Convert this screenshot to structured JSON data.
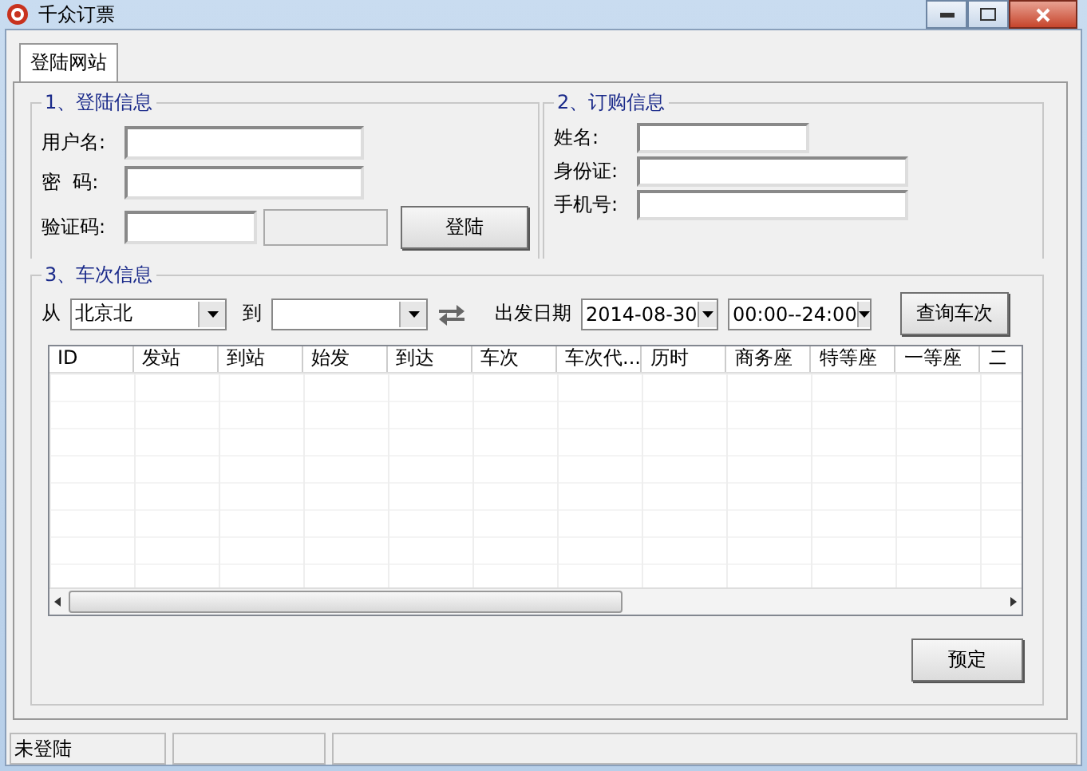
{
  "window": {
    "title": "千众订票"
  },
  "tabs": [
    {
      "label": "登陆网站",
      "selected": true
    }
  ],
  "login_group": {
    "title": "1、登陆信息",
    "fields": [
      {
        "label": "用户名:"
      },
      {
        "label": "密  码:"
      }
    ],
    "captcha_label": "验证码:",
    "login_button": "登陆"
  },
  "order_group": {
    "title": "2、订购信息",
    "fields": [
      {
        "label": "姓名:",
        "kind": "short"
      },
      {
        "label": "身份证:",
        "kind": "long"
      },
      {
        "label": "手机号:",
        "kind": "long"
      }
    ]
  },
  "train_group": {
    "title": "3、车次信息",
    "from_label": "从",
    "from_value": "北京北",
    "to_label": "到",
    "date_label": "出发日期",
    "date_value": "2014-08-30",
    "time_value": "00:00--24:00",
    "query_button": "查询车次",
    "table": {
      "columns": [
        "ID",
        "发站",
        "到站",
        "始发",
        "到达",
        "车次",
        "车次代...",
        "历时",
        "商务座",
        "特等座",
        "一等座",
        "二"
      ]
    },
    "reserve_button": "预定"
  },
  "status_bar": {
    "text": "未登陆"
  }
}
